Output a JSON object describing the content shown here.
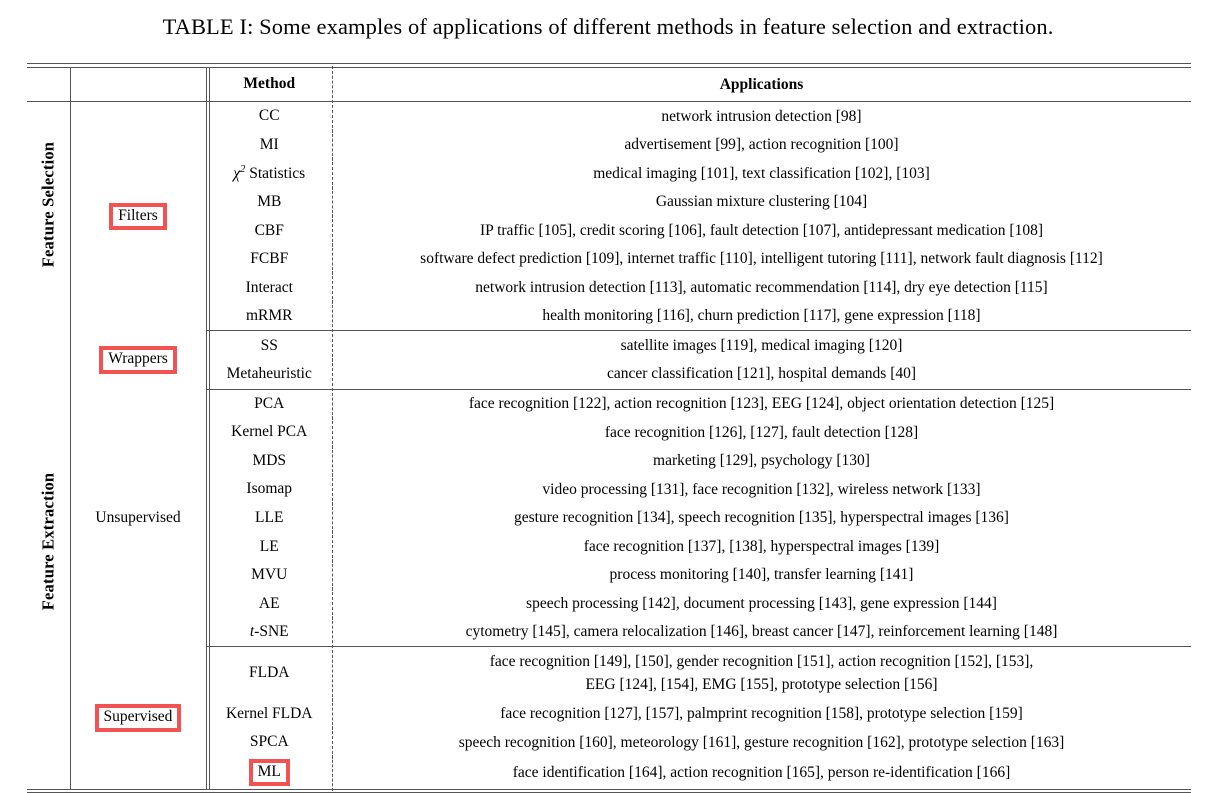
{
  "caption": "TABLE I: Some examples of applications of different methods in feature selection and extraction.",
  "colors": {
    "highlight_border": "#f25252",
    "rule": "#555555",
    "text": "#000000"
  },
  "header": {
    "method": "Method",
    "applications": "Applications"
  },
  "side_labels": {
    "feature_selection": "Feature Selection",
    "feature_extraction": "Feature Extraction"
  },
  "groups": [
    {
      "key": "filters",
      "label": "Filters",
      "highlighted": true
    },
    {
      "key": "wrappers",
      "label": "Wrappers",
      "highlighted": true
    },
    {
      "key": "unsupervised",
      "label": "Unsupervised",
      "highlighted": false
    },
    {
      "key": "supervised",
      "label": "Supervised",
      "highlighted": true
    }
  ],
  "rows": {
    "filters": [
      {
        "method": "CC",
        "applications": "network intrusion detection [98]"
      },
      {
        "method": "MI",
        "applications": "advertisement [99], action recognition [100]"
      },
      {
        "method": "χ² Statistics",
        "applications": "medical imaging [101], text classification [102], [103]"
      },
      {
        "method": "MB",
        "applications": "Gaussian mixture clustering [104]"
      },
      {
        "method": "CBF",
        "applications": "IP traffic [105], credit scoring [106], fault detection [107], antidepressant medication [108]"
      },
      {
        "method": "FCBF",
        "applications": "software defect prediction [109], internet traffic [110], intelligent tutoring [111], network fault diagnosis [112]"
      },
      {
        "method": "Interact",
        "applications": "network intrusion detection [113], automatic recommendation [114], dry eye detection [115]"
      },
      {
        "method": "mRMR",
        "applications": "health monitoring [116], churn prediction [117], gene expression [118]"
      }
    ],
    "wrappers": [
      {
        "method": "SS",
        "applications": "satellite images [119], medical imaging [120]"
      },
      {
        "method": "Metaheuristic",
        "applications": "cancer classification [121], hospital demands [40]"
      }
    ],
    "unsupervised": [
      {
        "method": "PCA",
        "applications": "face recognition [122], action recognition [123], EEG [124], object orientation detection [125]"
      },
      {
        "method": "Kernel PCA",
        "applications": "face recognition [126], [127], fault detection [128]"
      },
      {
        "method": "MDS",
        "applications": "marketing [129], psychology [130]"
      },
      {
        "method": "Isomap",
        "applications": "video processing [131], face recognition [132], wireless network [133]"
      },
      {
        "method": "LLE",
        "applications": "gesture recognition [134], speech recognition [135], hyperspectral images [136]"
      },
      {
        "method": "LE",
        "applications": "face recognition [137], [138], hyperspectral images [139]"
      },
      {
        "method": "MVU",
        "applications": "process monitoring [140], transfer learning [141]"
      },
      {
        "method": "AE",
        "applications": "speech processing [142], document processing [143], gene expression [144]"
      },
      {
        "method": "t-SNE",
        "applications": "cytometry [145], camera relocalization [146], breast cancer [147], reinforcement learning [148]"
      }
    ],
    "supervised": [
      {
        "method": "FLDA",
        "applications": "face recognition [149], [150], gender recognition [151], action recognition [152], [153],",
        "applications_line2": "EEG [124], [154], EMG [155], prototype selection [156]"
      },
      {
        "method": "Kernel FLDA",
        "applications": "face recognition [127], [157], palmprint recognition [158], prototype selection [159]"
      },
      {
        "method": "SPCA",
        "applications": "speech recognition [160], meteorology [161], gesture recognition [162], prototype selection [163]"
      },
      {
        "method": "ML",
        "applications": "face identification [164], action recognition [165], person re-identification [166]",
        "highlighted": true
      }
    ]
  }
}
